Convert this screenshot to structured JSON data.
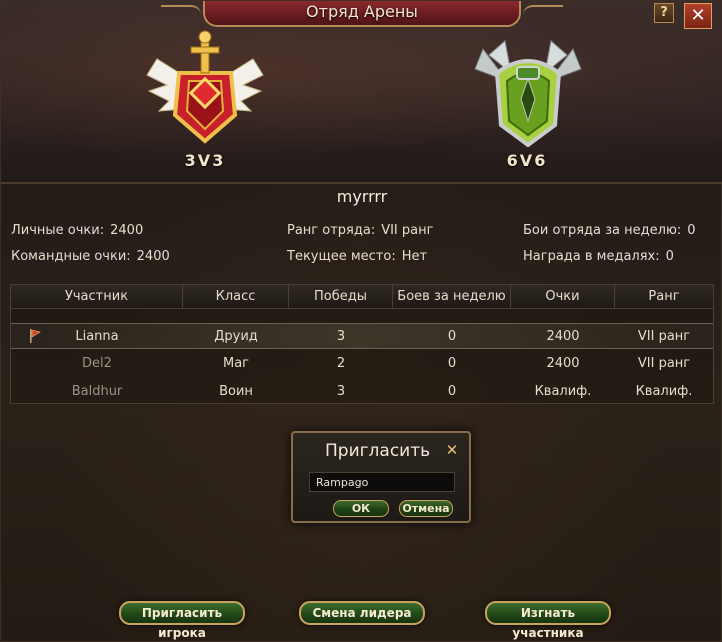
{
  "window": {
    "title": "Отряд Арены",
    "help_label": "?",
    "close_label": "✕"
  },
  "emblems": [
    {
      "label": "3V3",
      "icon": "gold-winged-shield-emblem-icon"
    },
    {
      "label": "6V6",
      "icon": "green-silver-shield-emblem-icon"
    }
  ],
  "team": {
    "name": "myrrrr",
    "personal_points_label": "Личные очки:",
    "personal_points_value": "2400",
    "team_points_label": "Командные очки:",
    "team_points_value": "2400",
    "rank_label": "Ранг отряда:",
    "rank_value": "VII ранг",
    "place_label": "Текущее место:",
    "place_value": "Нет",
    "weekly_battles_label": "Бои отряда за неделю:",
    "weekly_battles_value": "0",
    "medal_reward_label": "Награда в медалях:",
    "medal_reward_value": "0"
  },
  "table": {
    "headers": [
      "Участник",
      "Класс",
      "Победы",
      "Боев за неделю",
      "Очки",
      "Ранг"
    ],
    "rows": [
      {
        "name": "Lianna",
        "class": "Друид",
        "wins": "3",
        "weekly": "0",
        "points": "2400",
        "rank": "VII ранг",
        "leader": true,
        "selected": true
      },
      {
        "name": "Del2",
        "class": "Маг",
        "wins": "2",
        "weekly": "0",
        "points": "2400",
        "rank": "VII ранг",
        "leader": false,
        "selected": false
      },
      {
        "name": "Baldhur",
        "class": "Воин",
        "wins": "3",
        "weekly": "0",
        "points": "Квалиф.",
        "rank": "Квалиф.",
        "leader": false,
        "selected": false
      }
    ]
  },
  "invite_dialog": {
    "title": "Пригласить",
    "close_label": "✕",
    "input_value": "Rampago",
    "ok_label": "ОК",
    "cancel_label": "Отмена"
  },
  "buttons": {
    "invite_player": "Пригласить игрока",
    "change_leader": "Смена лидера",
    "kick_member": "Изгнать участника"
  },
  "colors": {
    "accent_gold": "#c9a35e",
    "title_red": "#6a1c20",
    "button_green": "#224817"
  }
}
